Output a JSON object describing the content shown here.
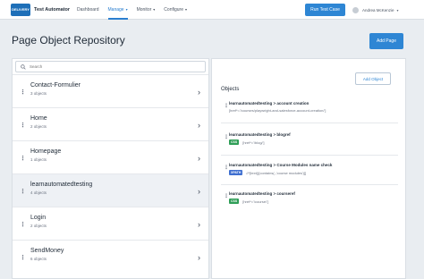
{
  "header": {
    "logo_text": "DELIVERY",
    "app_title": "Test Automator",
    "nav": [
      {
        "label": "Dashboard",
        "active": false,
        "dropdown": false
      },
      {
        "label": "Manage",
        "active": true,
        "dropdown": true
      },
      {
        "label": "Monitor",
        "active": false,
        "dropdown": true
      },
      {
        "label": "Configure",
        "active": false,
        "dropdown": true
      }
    ],
    "run_button": "Run Test Case",
    "user_name": "Andrea McKenzie"
  },
  "page": {
    "title": "Page Object Repository",
    "add_page_button": "Add Page"
  },
  "left": {
    "search_placeholder": "Search",
    "items": [
      {
        "name": "Contact-Formulier",
        "count": "3 objects",
        "selected": false
      },
      {
        "name": "Home",
        "count": "2 objects",
        "selected": false
      },
      {
        "name": "Homepage",
        "count": "1 objects",
        "selected": false
      },
      {
        "name": "learnautomatedtesting",
        "count": "4 objects",
        "selected": true
      },
      {
        "name": "Login",
        "count": "2 objects",
        "selected": false
      },
      {
        "name": "SendMoney",
        "count": "6 objects",
        "selected": false
      }
    ]
  },
  "right": {
    "add_object_button": "Add Object",
    "objects_label": "Objects",
    "objects": [
      {
        "title": "learnautomatedtesting > account creation",
        "badge": "",
        "locator": "[href*='/courses/playwright-and-salesforce-account-creation/']"
      },
      {
        "title": "learnautomatedtesting > blogref",
        "badge": "CSS",
        "locator": "[href*='/blog/']"
      },
      {
        "title": "learnautomatedtesting > Course Modules name check",
        "badge": "XPATH",
        "locator": "//*[text()[contains(.,'course modules')]]"
      },
      {
        "title": "learnautomatedtesting > courseref",
        "badge": "CSS",
        "locator": "[href*='/course/']"
      }
    ]
  },
  "colors": {
    "primary": "#2e86d4",
    "css_badge": "#2f9e57",
    "xpath_badge": "#3f6fd0"
  }
}
